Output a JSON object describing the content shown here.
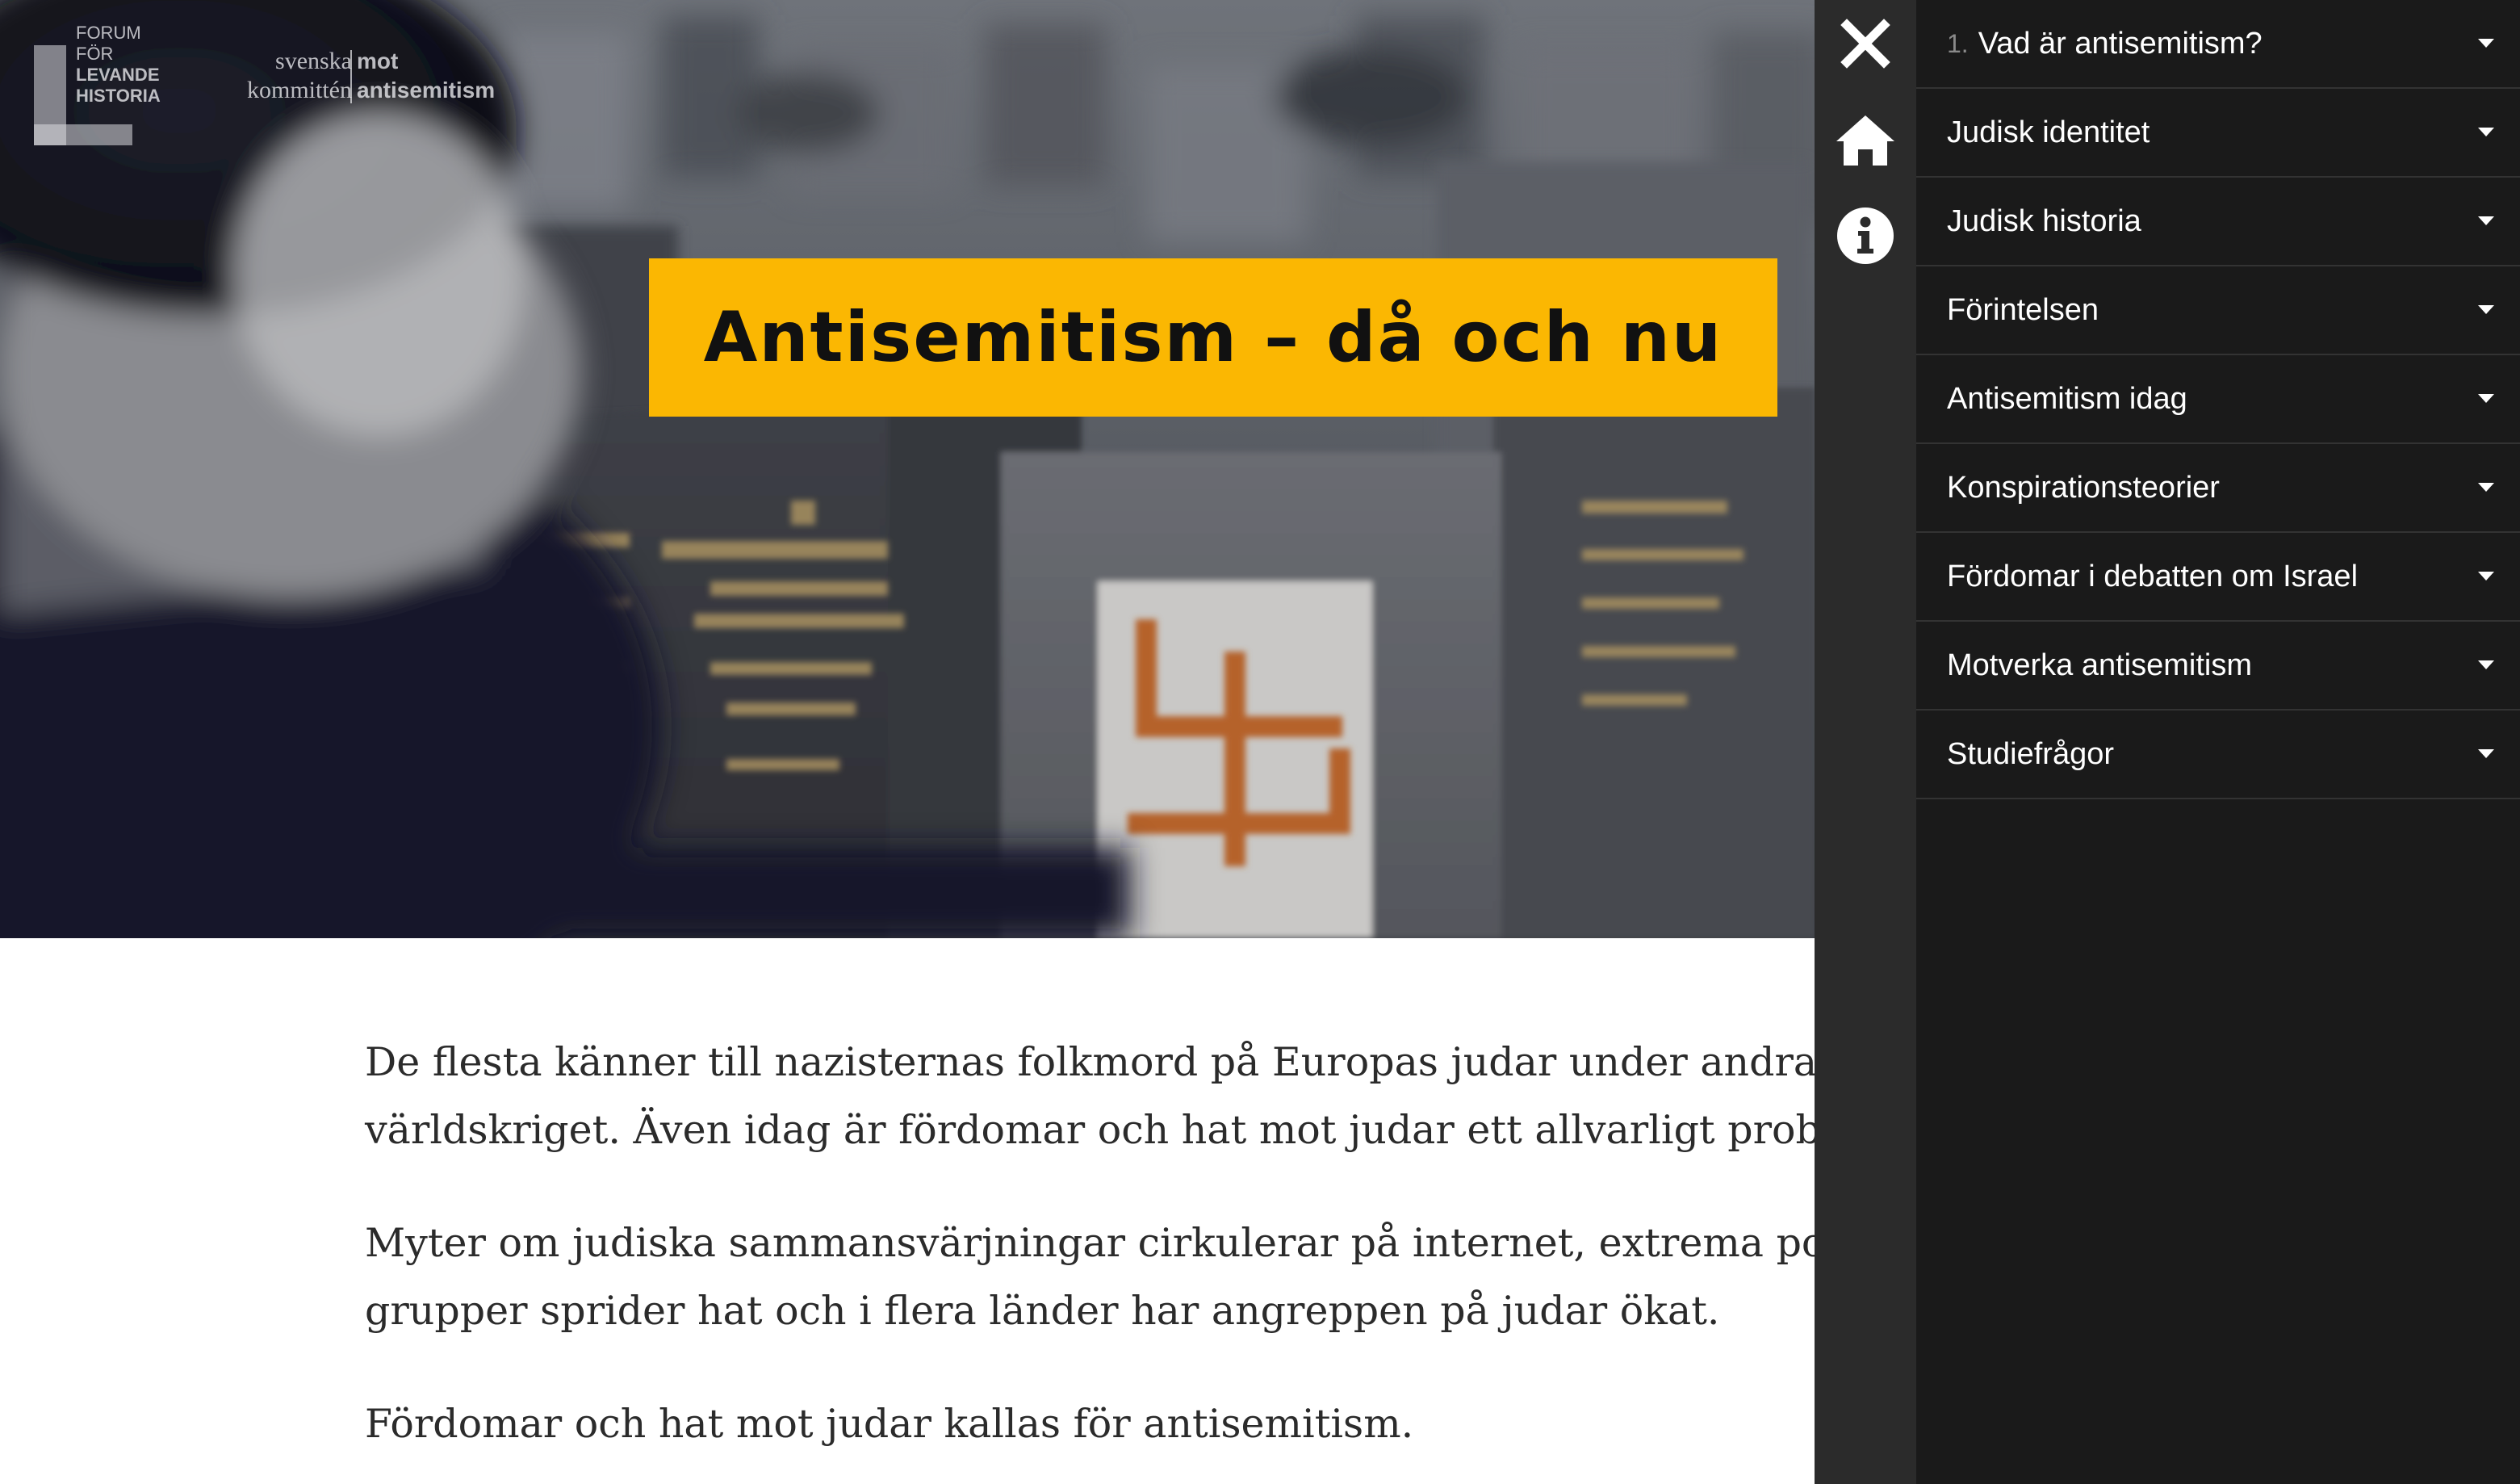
{
  "hero": {
    "title": "Antisemitism – då och nu",
    "title_bg_color": "#fbb702"
  },
  "logos": {
    "fflh": {
      "lines": [
        "FORUM",
        "FÖR",
        "LEVANDE",
        "HISTORIA"
      ]
    },
    "ska": {
      "left_lines": [
        "svenska",
        "kommittén"
      ],
      "right_lines": [
        "mot",
        "antisemitism"
      ]
    }
  },
  "article": {
    "paragraphs": [
      {
        "lines": [
          "De flesta känner till nazisternas folkmord på Europas judar under andra",
          "världskriget. Även idag är fördomar och hat mot judar ett allvarligt probl"
        ]
      },
      {
        "lines": [
          "Myter om judiska sammansvärjningar cirkulerar på internet, extrema pol",
          "grupper sprider hat och i flera länder har angreppen på judar ökat."
        ]
      },
      {
        "lines": [
          "Fördomar och hat mot judar kallas för antisemitism."
        ]
      }
    ]
  },
  "rail": {
    "close_icon": "close-icon",
    "home_icon": "home-icon",
    "info_icon": "info-icon"
  },
  "menu": {
    "items": [
      {
        "number": "1.",
        "label": "Vad är antisemitism?"
      },
      {
        "number": "",
        "label": "Judisk identitet"
      },
      {
        "number": "",
        "label": "Judisk historia"
      },
      {
        "number": "",
        "label": "Förintelsen"
      },
      {
        "number": "",
        "label": "Antisemitism idag"
      },
      {
        "number": "",
        "label": "Konspirationsteorier"
      },
      {
        "number": "",
        "label": "Fördomar i debatten om Israel"
      },
      {
        "number": "",
        "label": "Motverka antisemitism"
      },
      {
        "number": "",
        "label": "Studiefrågor"
      }
    ]
  },
  "colors": {
    "rail_bg": "#2b2b2b",
    "menu_bg": "#1a1a1a",
    "menu_divider": "#333333",
    "accent": "#fbb702"
  }
}
